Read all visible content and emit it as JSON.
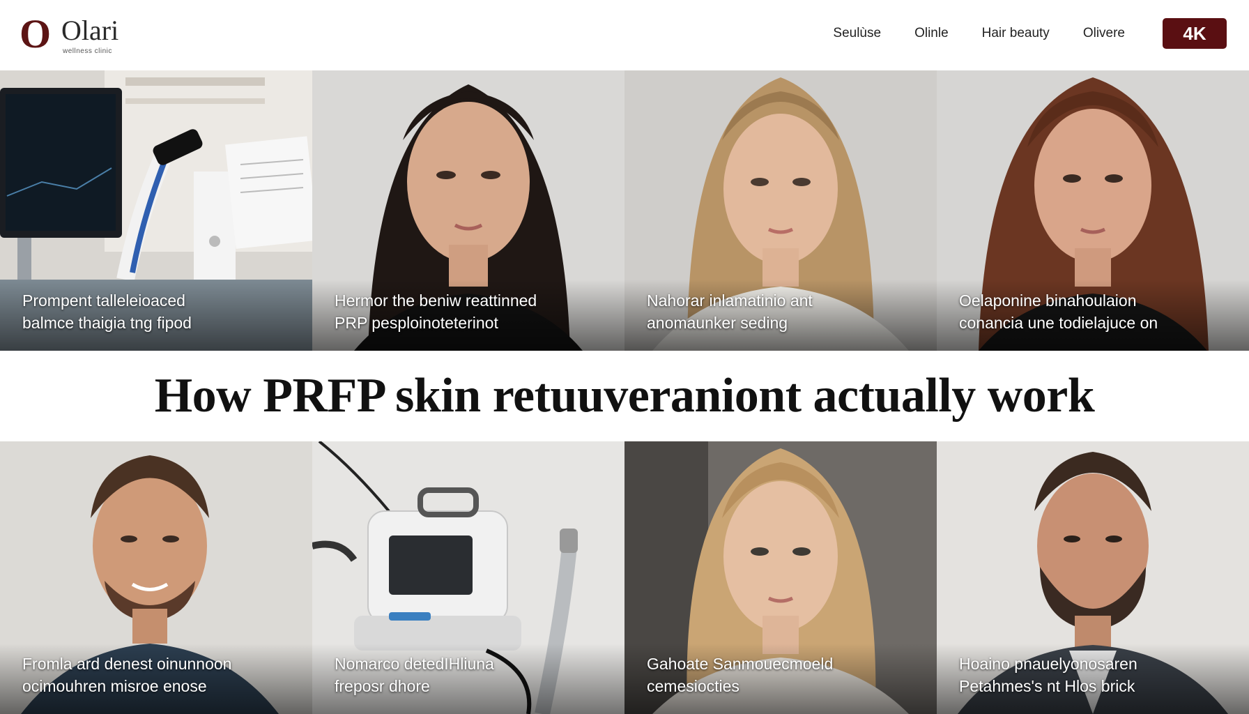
{
  "brand": {
    "mark": "O",
    "name": "Olari",
    "tagline": "wellness clinic"
  },
  "nav": {
    "items": [
      "Seulùse",
      "Olinle",
      "Hair beauty",
      "Olivere"
    ],
    "badge": "4K"
  },
  "headline": "How PRFP skin retuuveranion​t actually work",
  "tiles_top": [
    {
      "line1": "Prompent talleleioaced",
      "line2": "balmce thaigia tng fipod",
      "subject": "clinic-equipment"
    },
    {
      "line1": "Hermor the beniw reattinned",
      "line2": "PRP pesploinoteterinot",
      "subject": "woman-dark-hair"
    },
    {
      "line1": "Nahorar inlamatinio ant",
      "line2": "anomaunker seding",
      "subject": "woman-blonde-hair"
    },
    {
      "line1": "Oelaponine binahoulaion",
      "line2": "conancia une todielajuce on",
      "subject": "woman-auburn-hair"
    }
  ],
  "tiles_bottom": [
    {
      "line1": "Fromla ard denest oinunnoon",
      "line2": "ocimouhren misroe enose",
      "subject": "man-smiling"
    },
    {
      "line1": "Nomarco detedIHliuna",
      "line2": "freposr dhore",
      "subject": "rf-device"
    },
    {
      "line1": "Gahoate Sanmouecmoeld",
      "line2": "cemesiocties",
      "subject": "woman-blonde-wavy"
    },
    {
      "line1": "Hoaino pnauelyonosaren",
      "line2": "Petahmes's nt Hlos brick",
      "subject": "man-bearded"
    }
  ],
  "colors": {
    "accent": "#5a0f12",
    "text": "#111111"
  }
}
